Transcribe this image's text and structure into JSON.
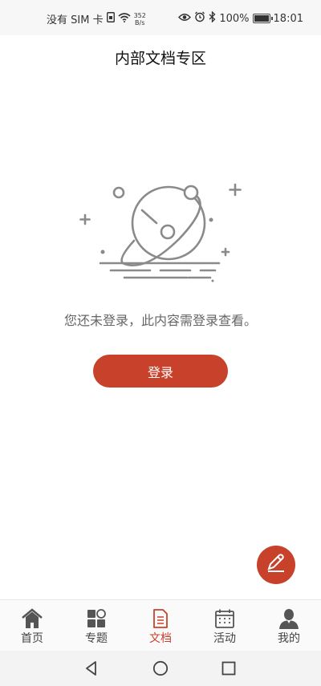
{
  "status_bar": {
    "carrier": "没有 SIM 卡",
    "net_speed_value": "352",
    "net_speed_unit": "B/s",
    "battery": "100%",
    "time": "18:01",
    "icons": [
      "sim-icon",
      "wifi-icon",
      "eye-icon",
      "alarm-icon",
      "bluetooth-icon",
      "battery-icon"
    ]
  },
  "header": {
    "title": "内部文档专区"
  },
  "main": {
    "illustration": "planet-empty-state-icon",
    "message": "您还未登录，此内容需登录查看。",
    "login_label": "登录"
  },
  "fab": {
    "icon": "pen-icon"
  },
  "tabs": [
    {
      "label": "首页",
      "icon": "home-icon",
      "active": false
    },
    {
      "label": "专题",
      "icon": "topics-icon",
      "active": false
    },
    {
      "label": "文档",
      "icon": "document-icon",
      "active": true
    },
    {
      "label": "活动",
      "icon": "calendar-icon",
      "active": false
    },
    {
      "label": "我的",
      "icon": "user-icon",
      "active": false
    }
  ],
  "nav_bar": {
    "icons": [
      "back-icon",
      "home-circle-icon",
      "recents-icon"
    ]
  },
  "colors": {
    "accent": "#c8412a",
    "inactive": "#555555"
  }
}
